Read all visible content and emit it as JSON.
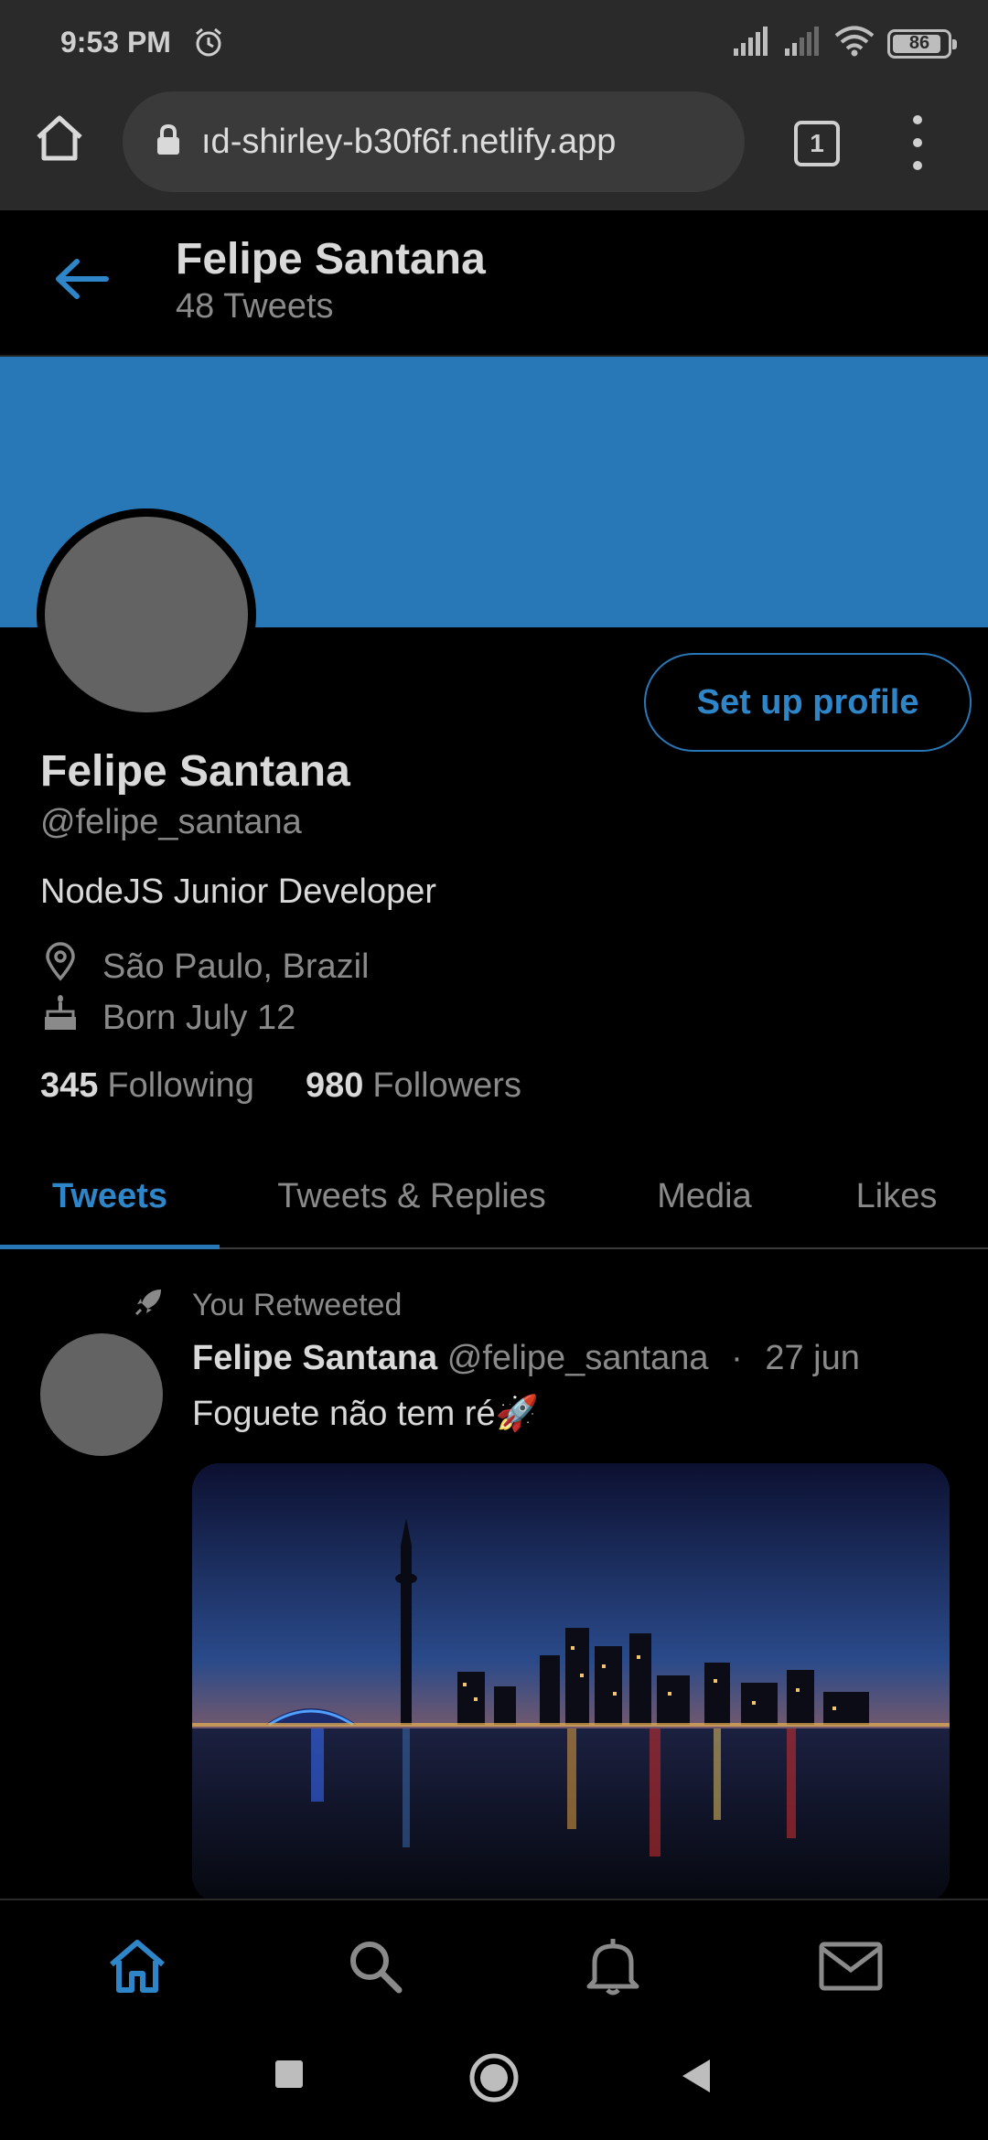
{
  "status_bar": {
    "time": "9:53 PM",
    "battery": "86",
    "icons": [
      "alarm-icon",
      "signal-icon",
      "signal-icon",
      "wifi-icon",
      "battery-icon"
    ]
  },
  "browser": {
    "url": "ıd-shirley-b30f6f.netlify.app",
    "tab_count": "1",
    "icons": [
      "home-icon",
      "lock-icon",
      "tabs-icon",
      "more-vertical-icon"
    ]
  },
  "header": {
    "name": "Felipe Santana",
    "tweet_count": "48 Tweets"
  },
  "profile": {
    "setup_button": "Set up profile",
    "name": "Felipe Santana",
    "handle": "@felipe_santana",
    "bio": "NodeJS Junior Developer",
    "location": "São Paulo, Brazil",
    "born": "Born July 12",
    "following_count": "345",
    "following_label": "Following",
    "followers_count": "980",
    "followers_label": "Followers",
    "banner_color": "#2878b8",
    "accent_color": "#2e86c9"
  },
  "tabs": [
    {
      "label": "Tweets",
      "active": true
    },
    {
      "label": "Tweets & Replies",
      "active": false
    },
    {
      "label": "Media",
      "active": false
    },
    {
      "label": "Likes",
      "active": false
    }
  ],
  "tweet": {
    "retweet_label": "You Retweeted",
    "author": "Felipe Santana",
    "handle": "@felipe_santana",
    "separator": "·",
    "date": "27 jun",
    "text": "Foguete não tem ré🚀",
    "image": "city-skyline-night-photo"
  },
  "bottom_nav": [
    "home-icon",
    "search-icon",
    "bell-icon",
    "mail-icon"
  ],
  "system_nav": [
    "recent-apps-icon",
    "home-circle-icon",
    "back-icon"
  ]
}
